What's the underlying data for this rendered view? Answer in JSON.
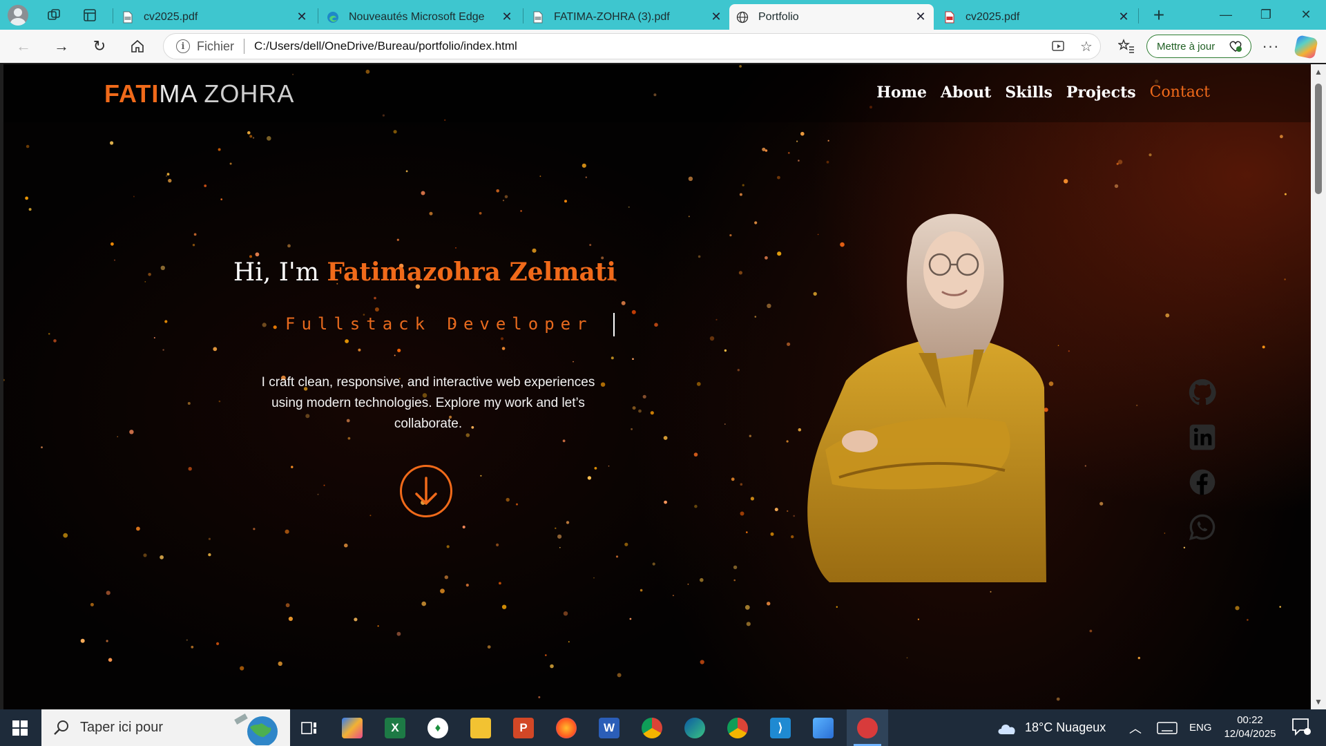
{
  "browser": {
    "tabs": [
      {
        "title": "cv2025.pdf",
        "icon": "pdf-icon"
      },
      {
        "title": "Nouveautés Microsoft Edge",
        "icon": "edge-icon"
      },
      {
        "title": "FATIMA-ZOHRA (3).pdf",
        "icon": "pdf-icon"
      },
      {
        "title": "Portfolio",
        "icon": "globe-icon",
        "active": true
      },
      {
        "title": "cv2025.pdf",
        "icon": "pdf-red-icon"
      }
    ],
    "scheme_label": "Fichier",
    "url": "C:/Users/dell/OneDrive/Bureau/portfolio/index.html",
    "update_label": "Mettre à jour"
  },
  "site": {
    "logo": {
      "part1": "FATI",
      "part2": "MA",
      "part3": " ZOHRA"
    },
    "nav": [
      "Home",
      "About",
      "Skills",
      "Projects",
      "Contact"
    ],
    "hero": {
      "greeting": "Hi, I'm ",
      "name": "Fatimazohra Zelmati",
      "role": "Fullstack Developer",
      "description": "I craft clean, responsive, and interactive web experiences using modern technologies. Explore my work and let’s collaborate."
    },
    "social": [
      "github-icon",
      "linkedin-icon",
      "facebook-icon",
      "whatsapp-icon"
    ],
    "colors": {
      "accent": "#f06a1a",
      "background": "#030202"
    }
  },
  "taskbar": {
    "search_placeholder": "Taper ici pour",
    "weather": "18°C  Nuageux",
    "language": "ENG",
    "time": "00:22",
    "date": "12/04/2025"
  }
}
